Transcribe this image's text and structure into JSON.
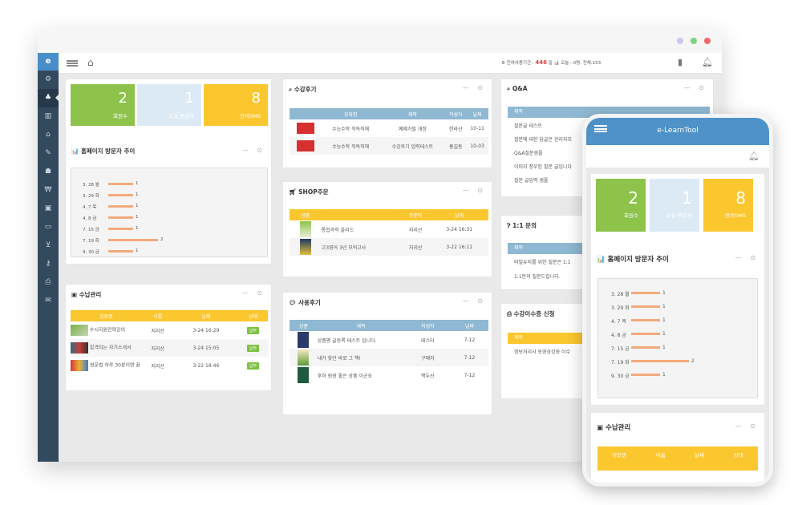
{
  "window_dots": [
    "#c9c8f0",
    "#7ed37e",
    "#f06a6a"
  ],
  "sidebar": {
    "logo": "e",
    "icons": [
      "gear-icon",
      "sitemap-icon",
      "chart-icon",
      "home-icon",
      "pencil-icon",
      "users-icon",
      "currency-icon",
      "video-icon",
      "card-icon",
      "cart-icon",
      "key-icon",
      "print-icon",
      "mail-icon"
    ]
  },
  "topbar": {
    "info_prefix": "⚙ 잔여사용기간 :",
    "remaining": "446",
    "info_suffix": "일  📊 오늘 : 0명, 전체:153"
  },
  "stats": [
    {
      "value": "2",
      "label": "회원수",
      "color": "#8dc24b"
    },
    {
      "value": "1",
      "label": "오늘 방문자",
      "color": "#dceaf5"
    },
    {
      "value": "8",
      "label": "잔여SMS",
      "color": "#fbc72f"
    }
  ],
  "visitors": {
    "title": "📊 홈페이지 방문자 추이",
    "chart_data": {
      "type": "bar",
      "categories": [
        "3. 28 월",
        "3. 29 화",
        "4. 7 목",
        "4. 8 금",
        "7. 15 금",
        "7. 19 화",
        "9. 30 금"
      ],
      "values": [
        1,
        1,
        1,
        1,
        1,
        2,
        1
      ]
    }
  },
  "payments": {
    "title": "수납관리",
    "headers": [
      "강좌명",
      "이름",
      "날짜",
      "상태"
    ],
    "rows": [
      {
        "name": "수시지원전략강의",
        "who": "지리산",
        "date": "3-24 16:29",
        "status": "납부"
      },
      {
        "name": "합격되는 자기소개서",
        "who": "지리산",
        "date": "3-24 15:05",
        "status": "납부"
      },
      {
        "name": "영문법 하루 30분이면 끝",
        "who": "지리산",
        "date": "3-22 18:46",
        "status": "납부"
      }
    ]
  },
  "reviews": {
    "title": "수강후기",
    "headers": [
      "강좌명",
      "제목",
      "작성자",
      "날짜"
    ],
    "rows": [
      {
        "course": "수능수학 직독직해",
        "title": "예제가필 개정",
        "author": "한라산",
        "date": "10-11"
      },
      {
        "course": "수능수학 직독직해",
        "title": "수강후기 입력테스트",
        "author": "홍길동",
        "date": "10-03"
      }
    ]
  },
  "shop": {
    "title": "SHOP주문",
    "headers": [
      "상품",
      "",
      "주문자",
      "날짜"
    ],
    "rows": [
      {
        "name": "통합과학 올리드",
        "who": "지리산",
        "date": "3-24 16:31"
      },
      {
        "name": "고3영어 3년 모의고사",
        "who": "지리산",
        "date": "3-22 16:11"
      }
    ]
  },
  "usage": {
    "title": "사용후기",
    "headers": [
      "상품",
      "제목",
      "작성자",
      "날짜"
    ],
    "rows": [
      {
        "title": "상품평 글등록 테스트 입니다.",
        "author": "테스터",
        "date": "7-12"
      },
      {
        "title": "내가 찾던 바로 그 책!",
        "author": "구매자",
        "date": "7-12"
      },
      {
        "title": "후하 원광 좋은 상품 이군요",
        "author": "백두산",
        "date": "7-12"
      }
    ]
  },
  "qa": {
    "title": "Q&A",
    "header": "제목",
    "items": [
      "질문글 테스트",
      "질문에 대한 답글은 관리자모",
      "Q&A질문샘플",
      "이미지 첨부된 질문 글입니다",
      "질문 글입력 샘플"
    ]
  },
  "oneone": {
    "title": "1:1 문의",
    "header": "제목",
    "items": [
      "비밀유지를 위한 질문은 1:1",
      "1:1문의 질문드립니다."
    ]
  },
  "cert": {
    "title": "수강이수증 신청",
    "header": "제목",
    "items": [
      "정보처리사 동영상강좌 이수"
    ]
  },
  "phone": {
    "app_title": "e-LearnTool",
    "pay_headers": [
      "강좌명",
      "이름",
      "날짜",
      "상태"
    ]
  }
}
